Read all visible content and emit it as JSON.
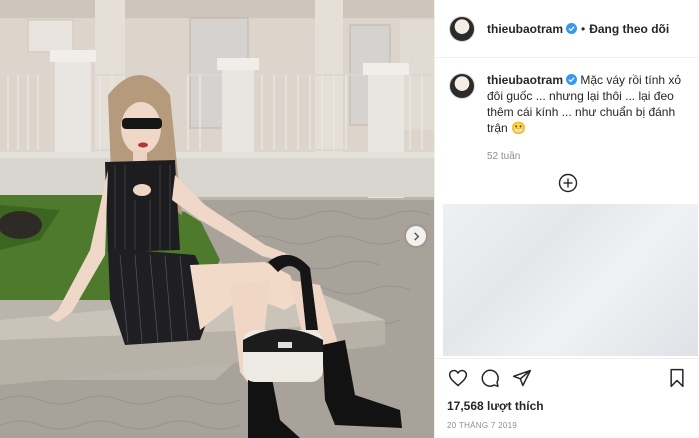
{
  "post": {
    "username": "thieubaotram",
    "follow_status": "Đang theo dõi",
    "dot": "•",
    "caption_text": "Mặc váy rồi tính xỏ đôi guốc ... nhưng lại thôi ... lại đeo thêm cái kính ... như chuẩn bị đánh trận 😬",
    "caption_time": "52 tuần",
    "likes": "17,568 lượt thích",
    "date": "20 THÁNG 7 2019"
  },
  "icons": {
    "verified": "verified-badge-icon",
    "load_more": "plus-circle-icon",
    "like": "heart-icon",
    "comment": "comment-icon",
    "share": "paper-plane-icon",
    "save": "bookmark-icon",
    "next": "chevron-right-icon"
  },
  "colors": {
    "verified_blue": "#3897f0",
    "text": "#262626",
    "muted": "#8e8e8e",
    "border": "#efefef"
  }
}
